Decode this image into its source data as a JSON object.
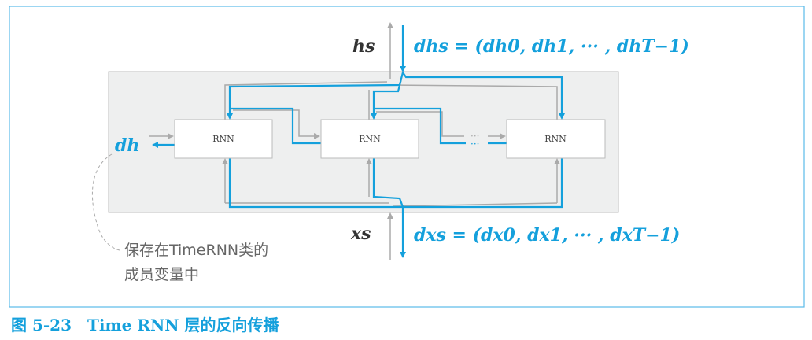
{
  "diagram": {
    "top_output_label": "hs",
    "top_gradient_label": "dhs = (dh0, dh1, ··· , dhT−1)",
    "bottom_input_label": "xs",
    "bottom_gradient_label": "dxs = (dx0, dx1, ··· , dxT−1)",
    "hidden_gradient_label": "dh",
    "blocks": [
      "RNN",
      "RNN",
      "RNN"
    ],
    "ellipsis": "···",
    "note_line1": "保存在TimeRNN类的",
    "note_line2": "成员变量中",
    "caption": "图 5-23　Time RNN 层的反向传播"
  },
  "colors": {
    "accent": "#14a0dc",
    "panel": "#eeefef",
    "frame": "#5bbbe8"
  }
}
